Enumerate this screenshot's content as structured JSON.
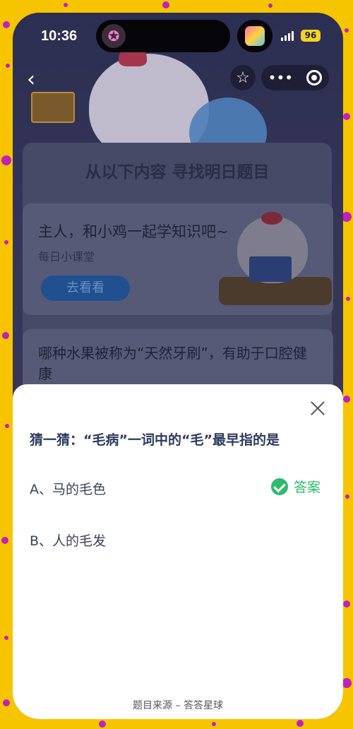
{
  "status_bar": {
    "time": "10:36",
    "battery": "96"
  },
  "nav": {
    "back_icon": "chevron-left-icon",
    "favorite_icon": "star-icon",
    "more_icon": "more-dots-icon",
    "target_icon": "target-icon"
  },
  "panel": {
    "title": "从以下内容 寻找明日题目",
    "lesson": {
      "title": "主人，和小鸡一起学知识吧~",
      "subtitle": "每日小课堂",
      "button": "去看看"
    },
    "question_preview": "哪种水果被称为“天然牙刷”，有助于口腔健康"
  },
  "sheet": {
    "question": "猜一猜：“毛病”一词中的“毛”最早指的是",
    "options": [
      {
        "label": "A、马的毛色",
        "is_answer": true
      },
      {
        "label": "B、人的毛发",
        "is_answer": false
      }
    ],
    "answer_label": "答案",
    "source": "题目来源 – 答答星球"
  },
  "colors": {
    "frame": "#f7c500",
    "confetti": "#c21ec0",
    "answer": "#2dbb6e",
    "question_text": "#2d3b5e"
  }
}
